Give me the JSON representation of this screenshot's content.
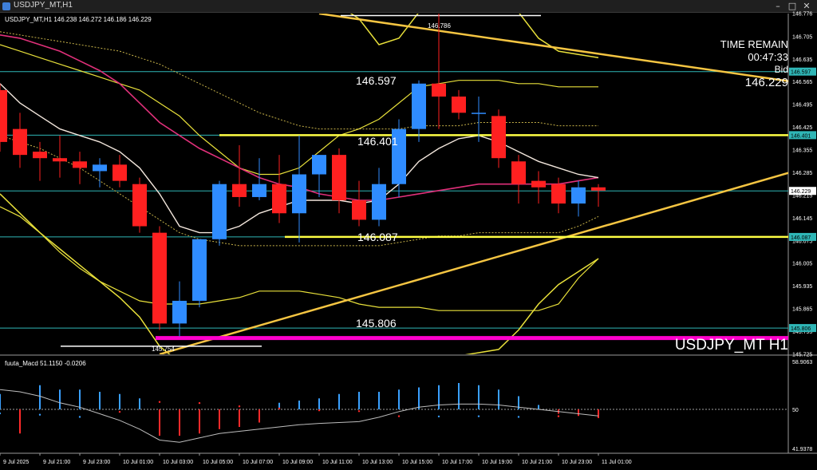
{
  "window": {
    "title": "USDJPY_MT,H1",
    "min_glyph": "–",
    "max_glyph": "□",
    "close_glyph": "✕"
  },
  "header": {
    "symbol_ohlc": "USDJPY_MT,H1  146.238 146.272 146.186 146.229"
  },
  "info": {
    "time_remain_label": "TIME REMAIN",
    "time_remain_value": "00:47:33",
    "bid_label": "Bid",
    "bid_value": "146.229",
    "watermark": "USDJPY_MT H1"
  },
  "levels": {
    "r1": "146.597",
    "r2": "146.401",
    "s1": "146.087",
    "s2": "145.806",
    "high": "146.786",
    "low": "145.754"
  },
  "macd": {
    "header": "fuuta_Macd 51.1150 -0.0206",
    "axis": [
      "58.9063",
      "50",
      "41.9378"
    ]
  },
  "colors": {
    "bull": "#2f8cff",
    "bear": "#ff2020",
    "band": "#e8e03a",
    "magenta": "#ff00cc",
    "trend": "#f5c542",
    "cyan": "#2fb6b6",
    "ma_white": "#f2e6dc",
    "ma_pink": "#e0307a"
  },
  "chart_data": {
    "type": "candlestick",
    "price_axis": [
      "146.776",
      "146.705",
      "146.635",
      "146.565",
      "146.495",
      "146.425",
      "146.355",
      "146.285",
      "146.215",
      "146.145",
      "146.075",
      "146.005",
      "145.935",
      "145.865",
      "145.795",
      "145.725"
    ],
    "price_tags": [
      "146.597",
      "146.401",
      "146.229",
      "146.087",
      "145.806"
    ],
    "ylim": [
      145.725,
      146.776
    ],
    "time_labels": [
      "9 Jul 2025",
      "9 Jul 21:00",
      "9 Jul 23:00",
      "10 Jul 01:00",
      "10 Jul 03:00",
      "10 Jul 05:00",
      "10 Jul 07:00",
      "10 Jul 09:00",
      "10 Jul 11:00",
      "10 Jul 13:00",
      "10 Jul 15:00",
      "10 Jul 17:00",
      "10 Jul 19:00",
      "10 Jul 21:00",
      "10 Jul 23:00",
      "11 Jul 01:00"
    ],
    "candles": [
      {
        "o": 146.54,
        "h": 146.56,
        "l": 146.35,
        "c": 146.38
      },
      {
        "o": 146.42,
        "h": 146.47,
        "l": 146.3,
        "c": 146.34
      },
      {
        "o": 146.35,
        "h": 146.38,
        "l": 146.26,
        "c": 146.33
      },
      {
        "o": 146.33,
        "h": 146.4,
        "l": 146.27,
        "c": 146.32
      },
      {
        "o": 146.32,
        "h": 146.35,
        "l": 146.25,
        "c": 146.3
      },
      {
        "o": 146.29,
        "h": 146.33,
        "l": 146.24,
        "c": 146.31
      },
      {
        "o": 146.31,
        "h": 146.34,
        "l": 146.24,
        "c": 146.26
      },
      {
        "o": 146.25,
        "h": 146.27,
        "l": 146.1,
        "c": 146.12
      },
      {
        "o": 146.1,
        "h": 146.12,
        "l": 145.8,
        "c": 145.82
      },
      {
        "o": 145.82,
        "h": 145.95,
        "l": 145.78,
        "c": 145.89
      },
      {
        "o": 145.89,
        "h": 146.05,
        "l": 145.87,
        "c": 146.08
      },
      {
        "o": 146.08,
        "h": 146.26,
        "l": 146.06,
        "c": 146.25
      },
      {
        "o": 146.25,
        "h": 146.37,
        "l": 146.18,
        "c": 146.21
      },
      {
        "o": 146.21,
        "h": 146.33,
        "l": 146.2,
        "c": 146.25
      },
      {
        "o": 146.25,
        "h": 146.34,
        "l": 146.13,
        "c": 146.16
      },
      {
        "o": 146.16,
        "h": 146.4,
        "l": 146.07,
        "c": 146.28
      },
      {
        "o": 146.28,
        "h": 146.34,
        "l": 146.21,
        "c": 146.34
      },
      {
        "o": 146.34,
        "h": 146.36,
        "l": 146.16,
        "c": 146.2
      },
      {
        "o": 146.2,
        "h": 146.26,
        "l": 146.12,
        "c": 146.14
      },
      {
        "o": 146.14,
        "h": 146.3,
        "l": 146.12,
        "c": 146.25
      },
      {
        "o": 146.25,
        "h": 146.45,
        "l": 146.21,
        "c": 146.42
      },
      {
        "o": 146.42,
        "h": 146.57,
        "l": 146.38,
        "c": 146.56
      },
      {
        "o": 146.56,
        "h": 146.79,
        "l": 146.42,
        "c": 146.52
      },
      {
        "o": 146.52,
        "h": 146.54,
        "l": 146.45,
        "c": 146.47
      },
      {
        "o": 146.47,
        "h": 146.52,
        "l": 146.38,
        "c": 146.47
      },
      {
        "o": 146.46,
        "h": 146.48,
        "l": 146.3,
        "c": 146.33
      },
      {
        "o": 146.32,
        "h": 146.34,
        "l": 146.19,
        "c": 146.25
      },
      {
        "o": 146.26,
        "h": 146.29,
        "l": 146.19,
        "c": 146.24
      },
      {
        "o": 146.25,
        "h": 146.27,
        "l": 146.16,
        "c": 146.19
      },
      {
        "o": 146.19,
        "h": 146.26,
        "l": 146.15,
        "c": 146.24
      },
      {
        "o": 146.24,
        "h": 146.25,
        "l": 146.18,
        "c": 146.23
      }
    ],
    "band_upper": [
      147.05,
      147.0,
      146.95,
      146.92,
      146.9,
      146.88,
      146.86,
      146.84,
      146.82,
      146.8,
      146.8,
      146.82,
      146.84,
      146.86,
      146.86,
      146.84,
      146.82,
      146.8,
      146.76,
      146.68,
      146.7,
      146.78,
      146.81,
      146.83,
      146.83,
      146.83,
      146.78,
      146.7,
      146.66,
      146.65,
      146.64
    ],
    "band_lower": [
      146.22,
      146.16,
      146.1,
      146.05,
      146.0,
      145.95,
      145.9,
      145.84,
      145.75,
      145.7,
      145.66,
      145.6,
      145.58,
      145.56,
      145.54,
      145.53,
      145.5,
      145.52,
      145.55,
      145.6,
      145.64,
      145.68,
      145.7,
      145.72,
      145.73,
      145.74,
      145.8,
      145.88,
      145.94,
      145.98,
      146.02
    ],
    "env_upper": [
      146.68,
      146.66,
      146.64,
      146.62,
      146.6,
      146.58,
      146.56,
      146.54,
      146.5,
      146.46,
      146.4,
      146.35,
      146.3,
      146.28,
      146.28,
      146.3,
      146.35,
      146.4,
      146.42,
      146.45,
      146.5,
      146.55,
      146.56,
      146.57,
      146.57,
      146.57,
      146.56,
      146.56,
      146.55,
      146.55,
      146.55
    ],
    "env_lower": [
      146.18,
      146.15,
      146.1,
      146.04,
      145.99,
      145.95,
      145.92,
      145.89,
      145.88,
      145.88,
      145.88,
      145.89,
      145.9,
      145.92,
      145.92,
      145.92,
      145.91,
      145.9,
      145.88,
      145.87,
      145.87,
      145.87,
      145.86,
      145.86,
      145.86,
      145.86,
      145.86,
      145.86,
      145.88,
      145.96,
      146.02
    ],
    "ma_fast": [
      146.56,
      146.5,
      146.46,
      146.42,
      146.4,
      146.38,
      146.35,
      146.3,
      146.22,
      146.12,
      146.1,
      146.1,
      146.12,
      146.16,
      146.18,
      146.2,
      146.2,
      146.2,
      146.19,
      146.2,
      146.25,
      146.32,
      146.36,
      146.39,
      146.4,
      146.38,
      146.35,
      146.32,
      146.3,
      146.28,
      146.27
    ],
    "ma_slow": [
      146.71,
      146.7,
      146.68,
      146.66,
      146.63,
      146.6,
      146.56,
      146.5,
      146.44,
      146.4,
      146.36,
      146.33,
      146.3,
      146.27,
      146.25,
      146.24,
      146.22,
      146.21,
      146.2,
      146.2,
      146.21,
      146.22,
      146.23,
      146.24,
      146.25,
      146.25,
      146.25,
      146.25,
      146.25,
      146.26,
      146.27
    ],
    "ma_dotted_upper": [
      146.72,
      146.71,
      146.7,
      146.69,
      146.68,
      146.67,
      146.66,
      146.64,
      146.62,
      146.59,
      146.56,
      146.53,
      146.5,
      146.47,
      146.45,
      146.43,
      146.42,
      146.42,
      146.42,
      146.42,
      146.42,
      146.43,
      146.43,
      146.43,
      146.44,
      146.44,
      146.44,
      146.44,
      146.43,
      146.43,
      146.43
    ],
    "ma_dotted_lower": [
      146.4,
      146.38,
      146.36,
      146.33,
      146.3,
      146.26,
      146.22,
      146.18,
      146.14,
      146.1,
      146.08,
      146.07,
      146.06,
      146.06,
      146.06,
      146.06,
      146.06,
      146.06,
      146.06,
      146.06,
      146.07,
      146.08,
      146.09,
      146.09,
      146.1,
      146.1,
      146.1,
      146.1,
      146.1,
      146.12,
      146.15
    ],
    "macd_hist": [
      0.35,
      -0.55,
      0.55,
      0.45,
      0.45,
      0.4,
      0.35,
      0.25,
      -0.6,
      -0.6,
      -0.55,
      -0.45,
      -0.4,
      -0.3,
      0.15,
      0.2,
      0.25,
      0.35,
      0.4,
      0.4,
      0.45,
      0.5,
      0.55,
      0.6,
      0.55,
      0.45,
      0.3,
      0.1,
      -0.1,
      -0.15,
      -0.2
    ],
    "macd_signal": [
      0.45,
      0.4,
      0.3,
      0.15,
      0.05,
      -0.1,
      -0.25,
      -0.45,
      -0.7,
      -0.75,
      -0.65,
      -0.55,
      -0.5,
      -0.45,
      -0.4,
      -0.35,
      -0.32,
      -0.3,
      -0.28,
      -0.18,
      -0.05,
      0.05,
      0.1,
      0.12,
      0.12,
      0.1,
      0.05,
      0.0,
      -0.05,
      -0.1,
      -0.15
    ]
  }
}
